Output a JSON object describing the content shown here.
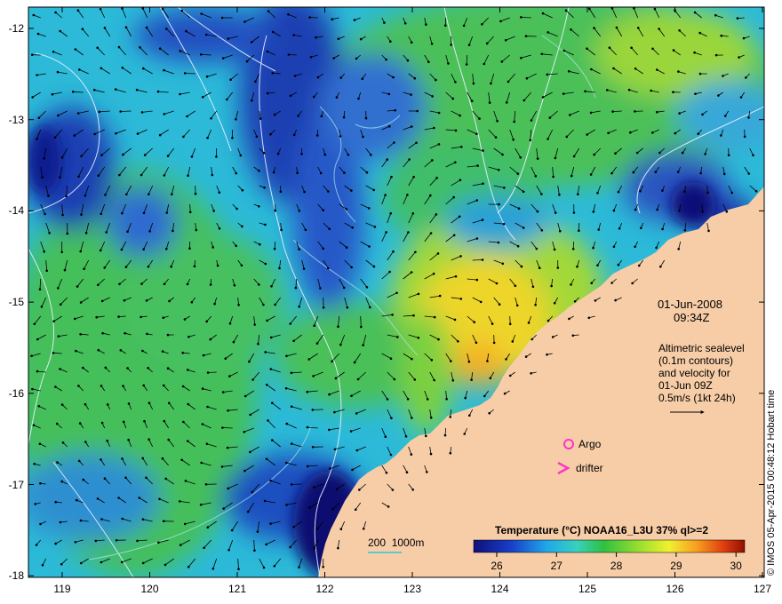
{
  "map": {
    "date": "01-Jun-2008",
    "time": "09:34Z",
    "altimetry_note": [
      "Altimetric sealevel",
      "(0.1m contours)",
      "and velocity for",
      "01-Jun 09Z",
      "0.5m/s (1kt 24h)"
    ],
    "credit": "© IMOS 05-Apr-2015 00:48:12 Hobart time",
    "depth_legend": "200  1000m",
    "argo_label": "Argo",
    "drifter_label": "drifter",
    "colorbar_title": "Temperature (°C) NOAA16_L3U 37% ql>=2",
    "colorbar_ticks": [
      "26",
      "27",
      "28",
      "29",
      "30"
    ],
    "x_ticks": [
      "119",
      "120",
      "121",
      "122",
      "123",
      "124",
      "125",
      "126",
      "127"
    ],
    "y_ticks": [
      "-12",
      "-13",
      "-14",
      "-15",
      "-16",
      "-17",
      "-18"
    ],
    "colors": {
      "land": "#f7cda7",
      "sst_cold": "#08086b",
      "sst_cool": "#2bb8e0",
      "sst_mid": "#3fc060",
      "sst_warm": "#f4d020",
      "argo_marker": "#ff33cc",
      "contour": "#e8f0ff"
    }
  }
}
